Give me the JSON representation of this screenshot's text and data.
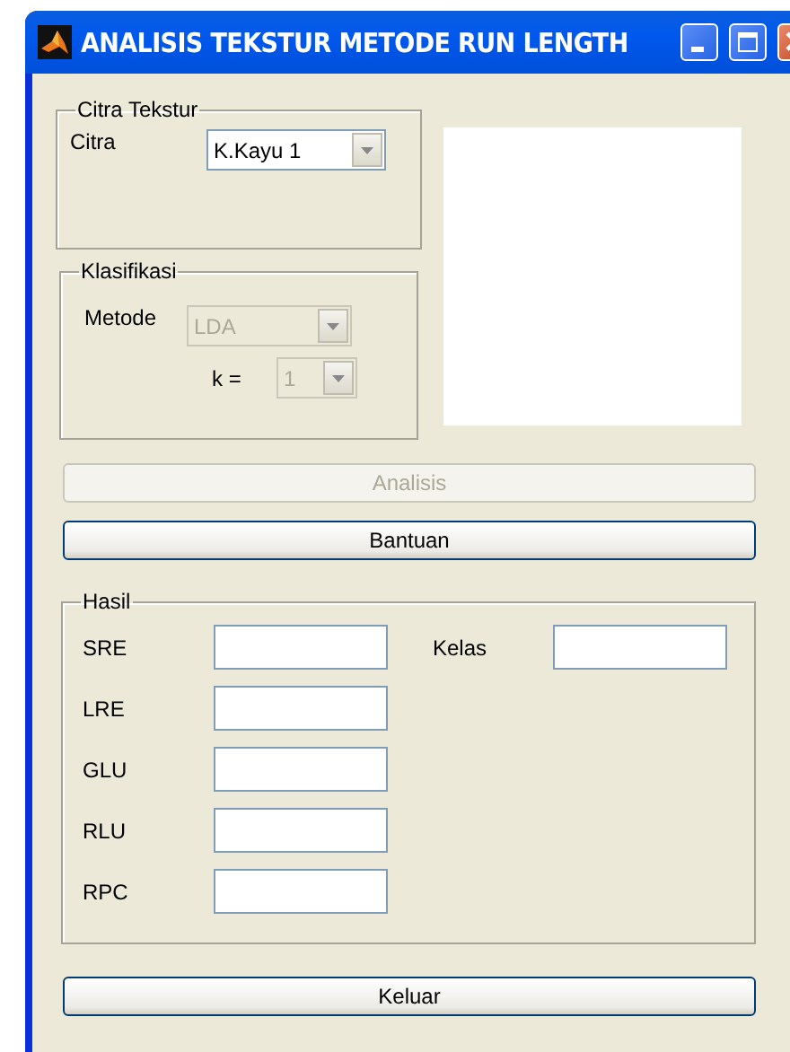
{
  "window": {
    "title": "ANALISIS TEKSTUR METODE RUN LENGTH"
  },
  "citra_tekstur": {
    "title": "Citra Tekstur",
    "label": "Citra",
    "popup": {
      "value": "K.Kayu 1",
      "disabled": false
    }
  },
  "klasifikasi": {
    "title": "Klasifikasi",
    "metode": {
      "label": "Metode",
      "popup": {
        "value": "LDA",
        "disabled": true
      }
    },
    "k": {
      "label": "k =",
      "popup": {
        "value": "1",
        "disabled": true
      }
    }
  },
  "buttons": [
    {
      "label": "Analisis",
      "disabled": true
    },
    {
      "label": "Bantuan",
      "disabled": false
    }
  ],
  "hasil": {
    "title": "Hasil",
    "fields": [
      {
        "label": "SRE"
      },
      {
        "label": "LRE"
      },
      {
        "label": "GLU"
      },
      {
        "label": "RLU"
      },
      {
        "label": "RPC"
      }
    ],
    "kelas": {
      "label": "Kelas"
    }
  },
  "exit_button": {
    "label": "Keluar",
    "disabled": false
  }
}
